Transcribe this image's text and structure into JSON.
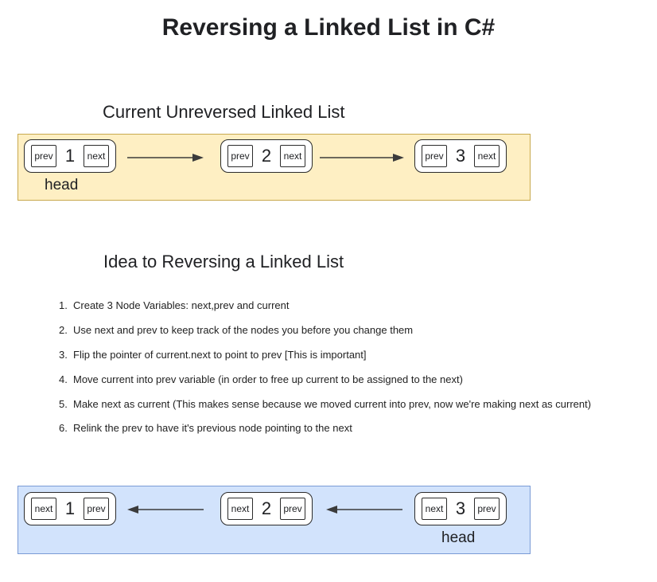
{
  "title": "Reversing a Linked List in C#",
  "section1": {
    "heading": "Current Unreversed Linked List",
    "headLabel": "head",
    "nodes": [
      {
        "left": "prev",
        "num": "1",
        "right": "next"
      },
      {
        "left": "prev",
        "num": "2",
        "right": "next"
      },
      {
        "left": "prev",
        "num": "3",
        "right": "next"
      }
    ]
  },
  "section2": {
    "heading": "Idea to Reversing a Linked List",
    "steps": [
      "Create 3 Node Variables: next,prev and current",
      "Use next and prev to keep track of the nodes you before you change them",
      "Flip the pointer of current.next to point to prev [This is important]",
      "Move current into prev variable (in order to free up current to be assigned to the next)",
      "Make next as current (This makes sense because we moved current into prev, now we're making next as current)",
      "Relink the prev to have it's previous node pointing to the next"
    ]
  },
  "section3": {
    "headLabel": "head",
    "nodes": [
      {
        "left": "next",
        "num": "1",
        "right": "prev"
      },
      {
        "left": "next",
        "num": "2",
        "right": "prev"
      },
      {
        "left": "next",
        "num": "3",
        "right": "prev"
      }
    ]
  }
}
